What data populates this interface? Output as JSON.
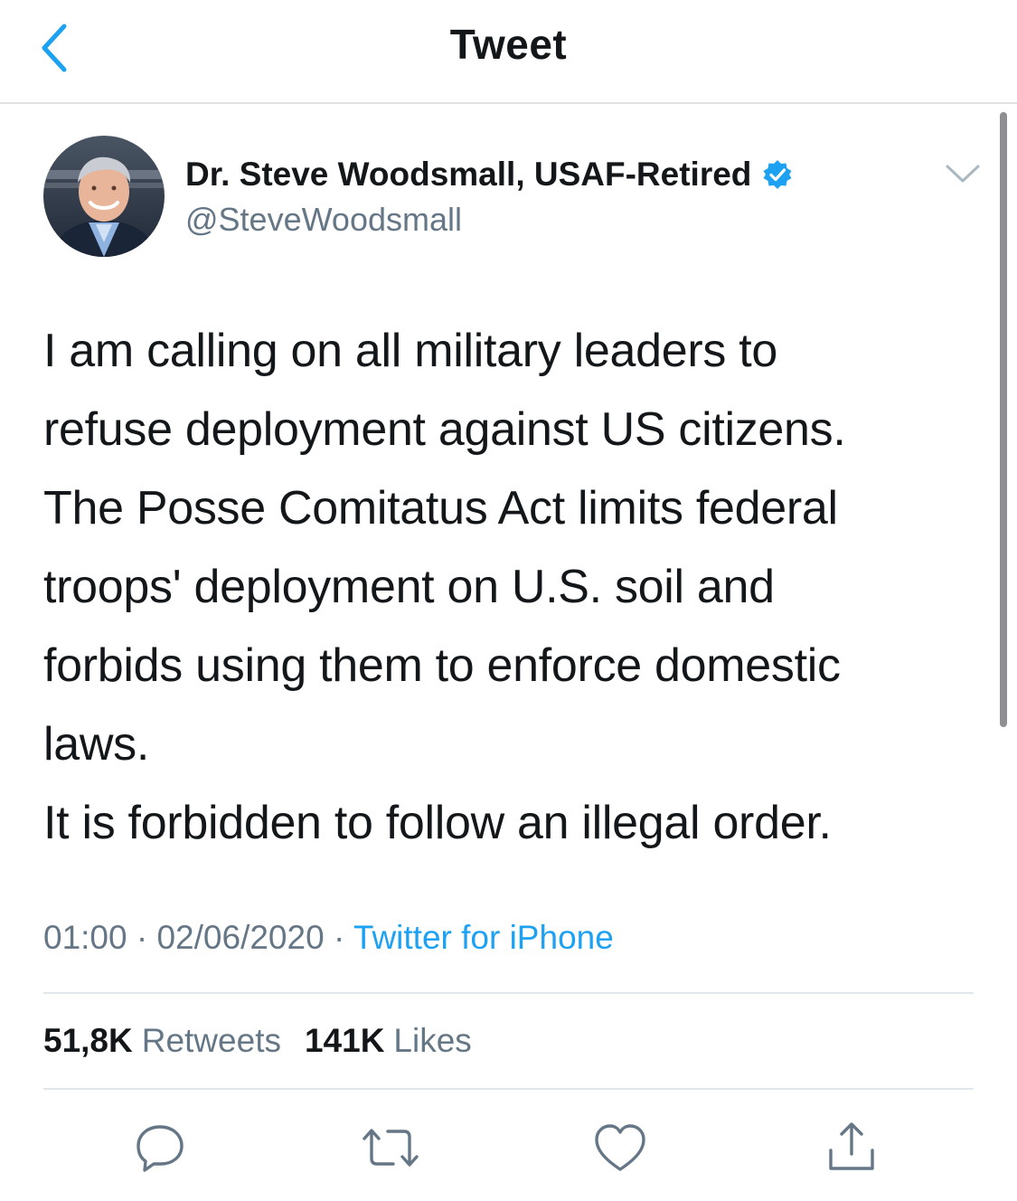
{
  "nav": {
    "title": "Tweet",
    "back_icon": "chevron-left-icon"
  },
  "colors": {
    "accent": "#1da1f2",
    "verified": "#1da1f2",
    "text": "#14171a",
    "secondary": "#657786",
    "divider": "#e1e8ed"
  },
  "tweet": {
    "author": {
      "name": "Dr. Steve Woodsmall, USAF-Retired",
      "handle": "@SteveWoodsmall",
      "verified_icon": "verified-badge-icon"
    },
    "text_lines": [
      "I am calling on all military leaders to",
      "refuse deployment against US citizens.",
      "The Posse Comitatus Act limits federal",
      "troops' deployment on U.S. soil and",
      "forbids using them to enforce domestic",
      "laws.",
      "It is forbidden to follow an illegal order."
    ],
    "time": "01:00",
    "date": "02/06/2020",
    "separator": "·",
    "source": "Twitter for iPhone"
  },
  "stats": {
    "retweets_count": "51,8K",
    "retweets_label": "Retweets",
    "likes_count": "141K",
    "likes_label": "Likes"
  },
  "actions": [
    {
      "icon": "reply-icon"
    },
    {
      "icon": "retweet-icon"
    },
    {
      "icon": "like-heart-icon"
    },
    {
      "icon": "share-icon"
    }
  ]
}
